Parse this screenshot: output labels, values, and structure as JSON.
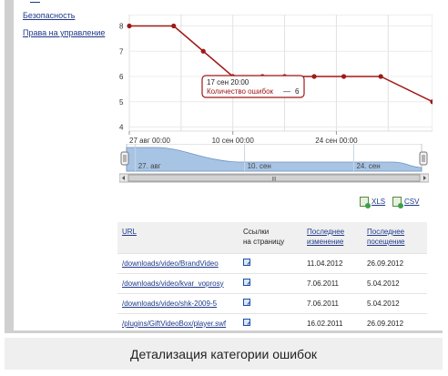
{
  "sidebar": {
    "items": [
      {
        "label": "Безопасность"
      },
      {
        "label": "Права на управление"
      }
    ]
  },
  "chart_data": {
    "type": "line",
    "color": "#a01818",
    "ylim": [
      4,
      8
    ],
    "yticks": [
      "4",
      "5",
      "6",
      "7",
      "8"
    ],
    "x_date_labels": [
      "27 авг 00:00",
      "10 сен 00:00",
      "24 сен 00:00"
    ],
    "series": [
      {
        "points": [
          {
            "x": "2012-08-27",
            "y": 8
          },
          {
            "x": "2012-09-02",
            "y": 8
          },
          {
            "x": "2012-09-06",
            "y": 7
          },
          {
            "x": "2012-09-10",
            "y": 6
          },
          {
            "x": "2012-09-14",
            "y": 6
          },
          {
            "x": "2012-09-17",
            "y": 6
          },
          {
            "x": "2012-09-21",
            "y": 6
          },
          {
            "x": "2012-09-25",
            "y": 6
          },
          {
            "x": "2012-09-30",
            "y": 6
          },
          {
            "x": "2012-10-07",
            "y": 5
          }
        ]
      }
    ],
    "tooltip": {
      "date": "17 сен 20:00",
      "series_label": "Количество ошибок",
      "separator": "—",
      "value": "6"
    }
  },
  "navigator": {
    "labels": [
      "27. авг",
      "10. сен",
      "24. сен"
    ],
    "fill_color": "#a8c4e4",
    "scroll_grip": "III"
  },
  "exports": [
    {
      "label": "XLS",
      "icon": "excel-icon"
    },
    {
      "label": "CSV",
      "icon": "csv-icon"
    }
  ],
  "table": {
    "headers": {
      "url": "URL",
      "links_line1": "Ссылки",
      "links_line2": "на страницу",
      "modified_line1": "Последнее",
      "modified_line2": "изменение",
      "visit_line1": "Последнее",
      "visit_line2": "посещение"
    },
    "rows": [
      {
        "url": "/downloads/video/BrandVideo",
        "modified": "11.04.2012",
        "visit": "26.09.2012"
      },
      {
        "url": "/downloads/video/kvar_voprosy",
        "modified": "7.06.2011",
        "visit": "5.04.2012"
      },
      {
        "url": "/downloads/video/shk-2009-5",
        "modified": "7.06.2011",
        "visit": "5.04.2012"
      },
      {
        "url": "/plugins/GiftVideoBox/player.swf",
        "modified": "16.02.2011",
        "visit": "26.09.2012"
      }
    ]
  },
  "caption": "Детализация категории ошибок"
}
